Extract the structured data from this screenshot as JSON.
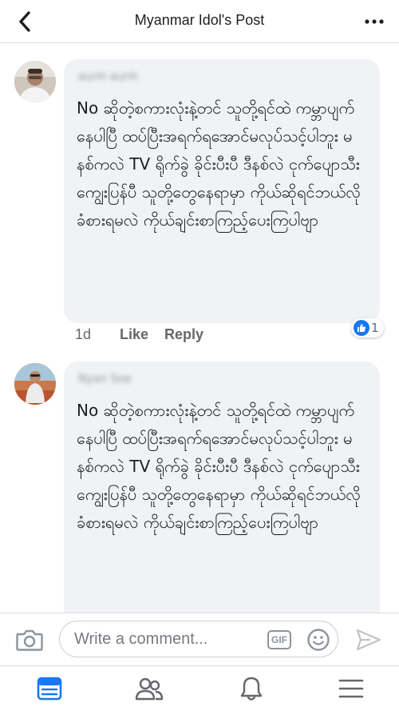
{
  "header": {
    "title": "Myanmar Idol's Post"
  },
  "comments": [
    {
      "author": "aunh aunh",
      "text": "No ဆိုတဲ့စကားလုံးနဲ့တင် သူတို့ရင်ထဲ ကမ္ဘာပျက်နေပါပြီ ထပ်ပြီးအရက်ရအောင်မလုပ်သင့်ပါဘူး မနစ်ကလဲ TV ရိုက်ခွဲ ခိုင်းပီးပီ ဒီနစ်လဲ ငုက်ပျောသီးကျွေးပြန်ပီ သူတို့တွေနေရာမှာ ကိုယ်ဆိုရင်ဘယ်လိုခံစားရမလဲ ကိုယ်ချင်းစာကြည့်ပေးကြပါဗျာ",
      "time": "1d",
      "like_label": "Like",
      "reply_label": "Reply",
      "reaction_count": "1"
    },
    {
      "author": "Nyan Soe",
      "text": "No ဆိုတဲ့စကားလုံးနဲ့တင် သူတို့ရင်ထဲ ကမ္ဘာပျက်နေပါပြီ ထပ်ပြီးအရက်ရအောင်မလုပ်သင့်ပါဘူး မနစ်ကလဲ TV ရိုက်ခွဲ ခိုင်းပီးပီ ဒီနစ်လဲ ငုက်ပျောသီးကျွေးပြန်ပီ သူတို့တွေနေရာမှာ ကိုယ်ဆိုရင်ဘယ်လိုခံစားရမလဲ ကိုယ်ချင်းစာကြည့်ပေးကြပါဗျာ"
    }
  ],
  "composer": {
    "placeholder": "Write a comment...",
    "gif_label": "GIF"
  },
  "colors": {
    "accent": "#1877f2",
    "bubble": "#f0f2f5",
    "secondary_text": "#65676b"
  },
  "icons": {
    "back": "chevron-left-icon",
    "more": "more-dots-icon",
    "camera": "camera-icon",
    "emoji": "emoji-icon",
    "send": "send-icon",
    "nav": [
      "news-feed-icon",
      "friends-icon",
      "notifications-icon",
      "menu-icon"
    ]
  }
}
